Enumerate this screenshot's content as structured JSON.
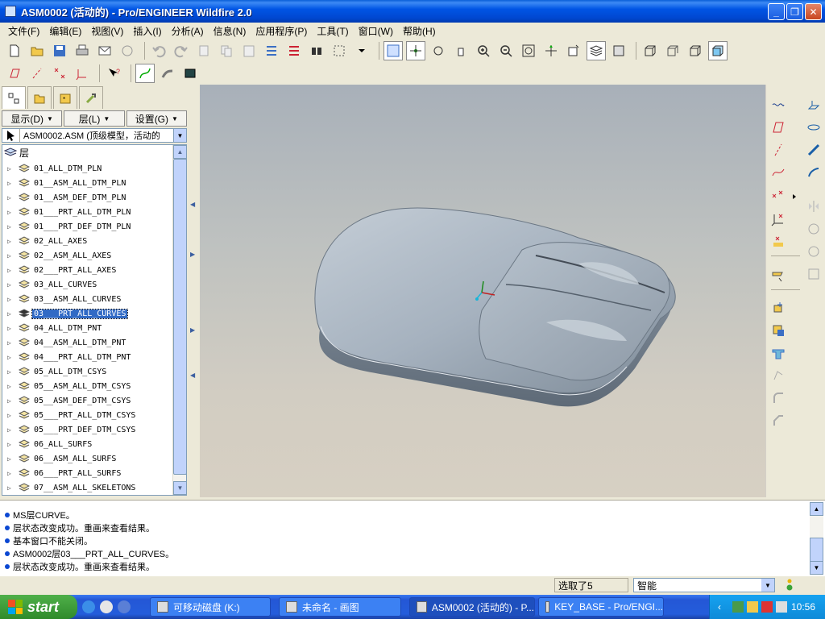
{
  "window": {
    "title": "ASM0002 (活动的) - Pro/ENGINEER Wildfire 2.0",
    "minimize": "_",
    "maximize": "❐",
    "close": "✕"
  },
  "menu": [
    "文件(F)",
    "编辑(E)",
    "视图(V)",
    "插入(I)",
    "分析(A)",
    "信息(N)",
    "应用程序(P)",
    "工具(T)",
    "窗口(W)",
    "帮助(H)"
  ],
  "navigator": {
    "buttons": {
      "show": "显示(D)",
      "layer": "层(L)",
      "settings": "设置(G)"
    },
    "model_select": "ASM0002.ASM (顶级模型，活动的",
    "tree_root": "层",
    "layers": [
      "01_ALL_DTM_PLN",
      "01__ASM_ALL_DTM_PLN",
      "01__ASM_DEF_DTM_PLN",
      "01___PRT_ALL_DTM_PLN",
      "01___PRT_DEF_DTM_PLN",
      "02_ALL_AXES",
      "02__ASM_ALL_AXES",
      "02___PRT_ALL_AXES",
      "03_ALL_CURVES",
      "03__ASM_ALL_CURVES",
      "03___PRT_ALL_CURVES",
      "04_ALL_DTM_PNT",
      "04__ASM_ALL_DTM_PNT",
      "04___PRT_ALL_DTM_PNT",
      "05_ALL_DTM_CSYS",
      "05__ASM_ALL_DTM_CSYS",
      "05__ASM_DEF_DTM_CSYS",
      "05___PRT_ALL_DTM_CSYS",
      "05___PRT_DEF_DTM_CSYS",
      "06_ALL_SURFS",
      "06__ASM_ALL_SURFS",
      "06___PRT_ALL_SURFS",
      "07__ASM_ALL_SKELETONS"
    ],
    "selected_layer": "03___PRT_ALL_CURVES"
  },
  "messages": [
    "MS层CURVE。",
    "层状态改变成功。重画来查看结果。",
    "基本窗口不能关闭。",
    "ASM0002层03___PRT_ALL_CURVES。",
    "层状态改变成功。重画来查看结果。"
  ],
  "status": {
    "selected": "选取了5",
    "filter": "智能"
  },
  "taskbar": {
    "start": "start",
    "tasks": [
      "可移动磁盘 (K:)",
      "未命名 - 画图",
      "ASM0002 (活动的) - P...",
      "KEY_BASE - Pro/ENGI..."
    ],
    "clock": "10:56"
  },
  "colors": {
    "title_bar": "#0055e5",
    "selection": "#316ac5",
    "viewport_top": "#a8b0b9",
    "viewport_bottom": "#d7d0c3",
    "model_surface": "#a9b5c2"
  }
}
